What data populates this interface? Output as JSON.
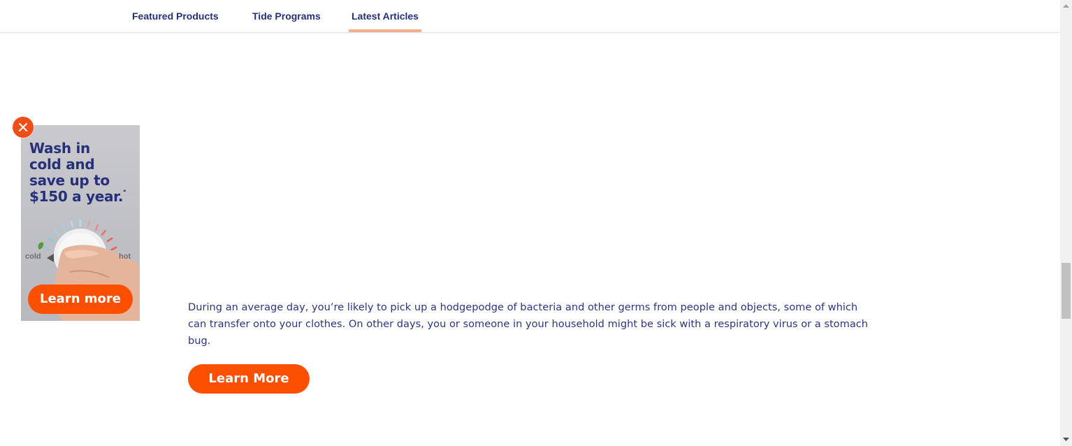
{
  "nav": {
    "tabs": [
      {
        "label": "Featured Products",
        "active": false
      },
      {
        "label": "Tide Programs",
        "active": false
      },
      {
        "label": "Latest Articles",
        "active": true
      }
    ],
    "active_underline_color": "#f5b08b",
    "text_color": "#26307a"
  },
  "ad": {
    "close_icon": "close-icon",
    "headline_lines": [
      "Wash in",
      "cold and",
      "save up to",
      "$150 a year."
    ],
    "headline_mark": "*",
    "dial_label_cold": "cold",
    "dial_label_hot": "hot",
    "button_label": "Learn more",
    "accent_color": "#fc5000"
  },
  "article": {
    "body": "During an average day, you’re likely to pick up a hodgepodge of bacteria and other germs from people and objects, some of which can transfer onto your clothes. On other days, you or someone in your household might be sick with a respiratory virus or a stomach bug.",
    "button_label": "Learn More"
  },
  "colors": {
    "brand_orange": "#fc5000",
    "brand_navy": "#26307a"
  }
}
